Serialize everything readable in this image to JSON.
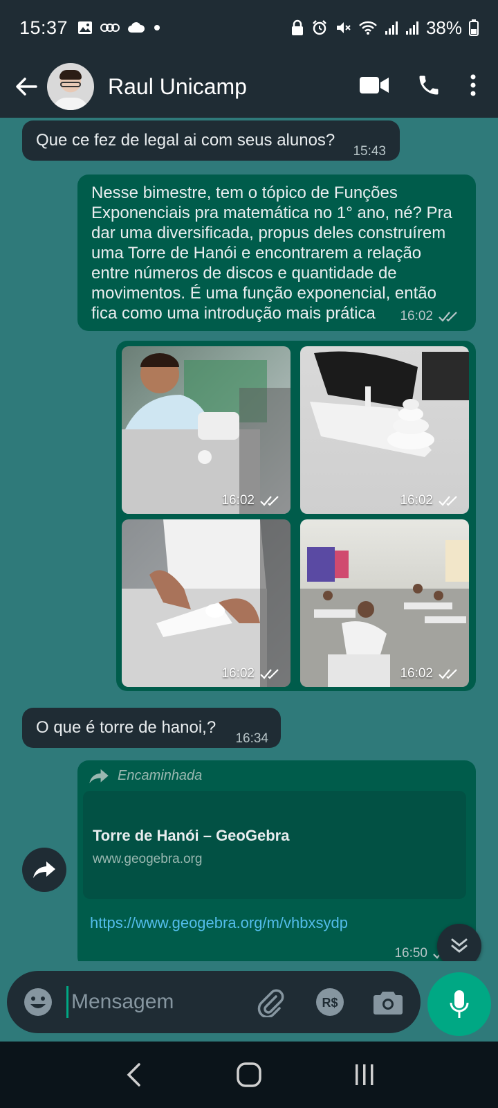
{
  "status_bar": {
    "time": "15:37",
    "battery": "38%",
    "icons": [
      "image-icon",
      "voicemail-icon",
      "cloud-icon",
      "dot-icon",
      "lock-icon",
      "alarm-icon",
      "mute-icon",
      "wifi-icon",
      "signal-icon",
      "signal-icon",
      "battery-icon"
    ]
  },
  "header": {
    "contact_name": "Raul Unicamp",
    "icons": [
      "back-arrow-icon",
      "video-call-icon",
      "phone-icon",
      "more-vert-icon"
    ]
  },
  "messages": [
    {
      "direction": "incoming",
      "text": "Que ce fez de legal ai com seus alunos?",
      "time": "15:43"
    },
    {
      "direction": "outgoing",
      "lines": [
        "Nesse bimestre, tem o tópico de Funções",
        "Exponenciais pra matemática no 1° ano, né? Pra",
        "dar uma diversificada, propus deles construírem",
        "uma Torre de Hanói e encontrarem a relação",
        "entre números de discos e quantidade de",
        "movimentos. É uma função exponencial, então",
        "fica como uma introdução mais prática"
      ],
      "time": "16:02"
    },
    {
      "direction": "outgoing",
      "type": "photos",
      "times": [
        "16:02",
        "16:02",
        "16:02",
        "16:02"
      ]
    },
    {
      "direction": "incoming",
      "text": "O que é torre de hanoi,?",
      "time": "16:34"
    },
    {
      "direction": "outgoing",
      "type": "link",
      "forwarded_label": "Encaminhada",
      "link_title": "Torre de Hanói – GeoGebra",
      "link_domain": "www.geogebra.org",
      "url": "https://www.geogebra.org/m/vhbxsydp",
      "time": "16:50"
    }
  ],
  "input": {
    "placeholder": "Mensagem",
    "icons": [
      "emoji-icon",
      "attach-icon",
      "payment-icon",
      "camera-icon",
      "mic-icon"
    ]
  },
  "colors": {
    "header_bg": "#1f2c34",
    "chat_bg": "#2f7a7a",
    "outgoing_bubble": "#005c4b",
    "incoming_bubble": "#1f2c34",
    "accent": "#00a884",
    "link": "#53bdeb"
  }
}
